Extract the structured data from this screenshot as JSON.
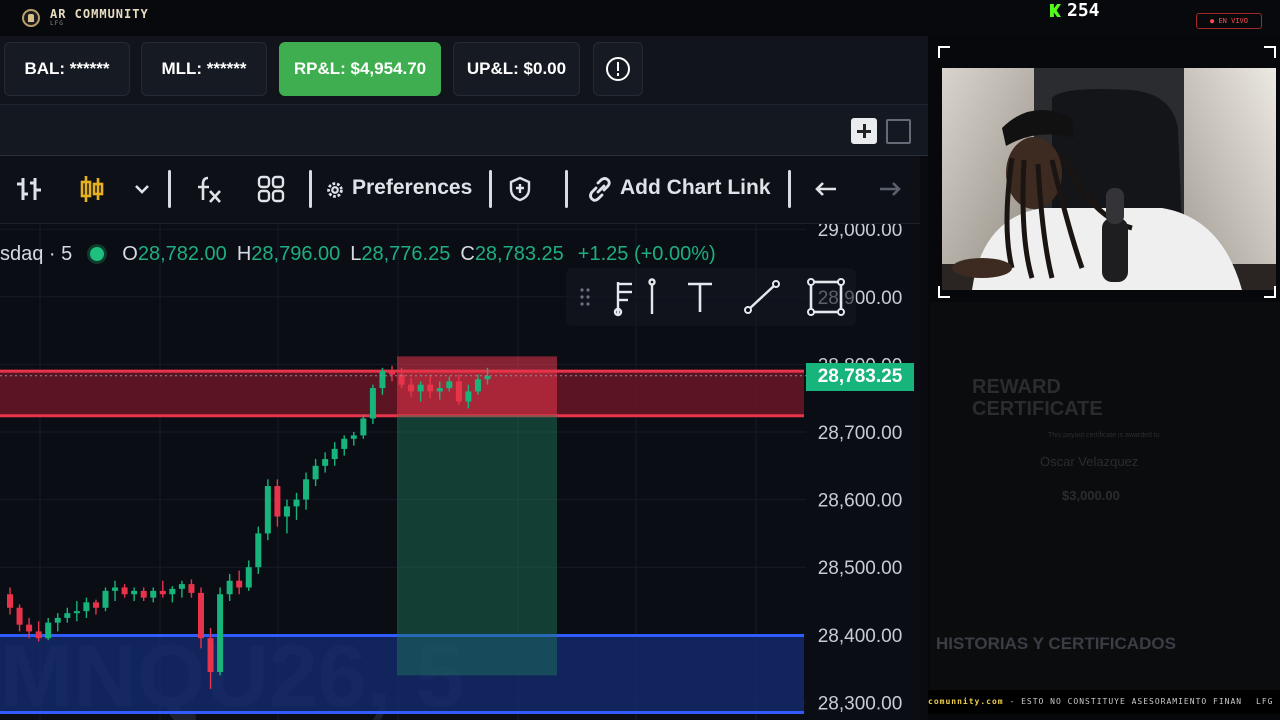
{
  "overlay": {
    "brand_name": "AR COMMUNITY",
    "brand_sub": "LFG",
    "viewer_count": "254",
    "live_label": "● EN VIVO"
  },
  "account": {
    "balance": "BAL: ******",
    "mll": "MLL: ******",
    "rpl": "RP&L: $4,954.70",
    "upl": "UP&L: $0.00"
  },
  "toolbar": {
    "preferences_label": "Preferences",
    "add_chart_link_label": "Add Chart Link"
  },
  "chart": {
    "symbol": "sdaq · 5",
    "open_label": "O",
    "open": "28,782.00",
    "high_label": "H",
    "high": "28,796.00",
    "low_label": "L",
    "low": "28,776.25",
    "close_label": "C",
    "close": "28,783.25",
    "change": "+1.25 (+0.00%)",
    "last_price": "28,783.25",
    "watermark": "MNQU26, 5",
    "price_axis": [
      "29,000.00",
      "28,900.00",
      "28,800.00",
      "28,700.00",
      "28,600.00",
      "28,500.00",
      "28,400.00",
      "28,300.00"
    ],
    "colors": {
      "up": "#17b57b",
      "down": "#e8344a",
      "resistance": "#e8344a",
      "support": "#2f5bff"
    }
  },
  "sidebar": {
    "cert_title_1": "REWARD",
    "cert_title_2": "CERTIFICATE",
    "cert_sub": "This payout certificate is awarded to",
    "cert_name": "Oscar Velazquez",
    "cert_amount": "$3,000.00",
    "stories_label": "HISTORIAS Y CERTIFICADOS",
    "ticker_domain": "comunnity.com",
    "ticker_text": " - ESTO NO CONSTITUYE ASESORAMIENTO FINAN",
    "ticker_tag": "LFG"
  }
}
